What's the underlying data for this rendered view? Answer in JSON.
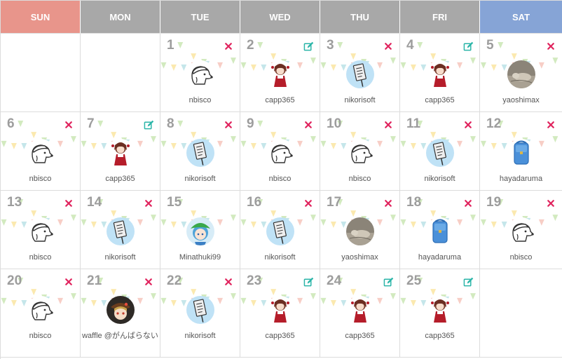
{
  "weekdays": [
    {
      "label": "SUN",
      "color": "#e8958b"
    },
    {
      "label": "MON",
      "color": "#a8a8a8"
    },
    {
      "label": "TUE",
      "color": "#a8a8a8"
    },
    {
      "label": "WED",
      "color": "#a8a8a8"
    },
    {
      "label": "THU",
      "color": "#a8a8a8"
    },
    {
      "label": "FRI",
      "color": "#a8a8a8"
    },
    {
      "label": "SAT",
      "color": "#86a4d6"
    }
  ],
  "colors": {
    "delete": "#e0245e",
    "edit": "#2bb5a8",
    "day_number": "#9d9d9d",
    "border": "#dcdcdc"
  },
  "weeks": [
    [
      {
        "day": "",
        "user": "",
        "avatar": "none",
        "action": "none"
      },
      {
        "day": "",
        "user": "",
        "avatar": "none",
        "action": "none"
      },
      {
        "day": "1",
        "user": "nbisco",
        "avatar": "dog-cap",
        "action": "delete"
      },
      {
        "day": "2",
        "user": "capp365",
        "avatar": "red-girl",
        "action": "edit"
      },
      {
        "day": "3",
        "user": "nikorisoft",
        "avatar": "sign-board",
        "action": "delete"
      },
      {
        "day": "4",
        "user": "capp365",
        "avatar": "red-girl",
        "action": "edit"
      },
      {
        "day": "5",
        "user": "yaoshimax",
        "avatar": "cat-photo",
        "action": "delete"
      }
    ],
    [
      {
        "day": "6",
        "user": "nbisco",
        "avatar": "dog-cap",
        "action": "delete"
      },
      {
        "day": "7",
        "user": "capp365",
        "avatar": "red-girl",
        "action": "edit"
      },
      {
        "day": "8",
        "user": "nikorisoft",
        "avatar": "sign-board",
        "action": "delete"
      },
      {
        "day": "9",
        "user": "nbisco",
        "avatar": "dog-cap",
        "action": "delete"
      },
      {
        "day": "10",
        "user": "nbisco",
        "avatar": "dog-cap",
        "action": "delete"
      },
      {
        "day": "11",
        "user": "nikorisoft",
        "avatar": "sign-board",
        "action": "delete"
      },
      {
        "day": "12",
        "user": "hayadaruma",
        "avatar": "blue-backpack",
        "action": "delete"
      }
    ],
    [
      {
        "day": "13",
        "user": "nbisco",
        "avatar": "dog-cap",
        "action": "delete"
      },
      {
        "day": "14",
        "user": "nikorisoft",
        "avatar": "sign-board",
        "action": "delete"
      },
      {
        "day": "15",
        "user": "Minathuki99",
        "avatar": "green-hat-girl",
        "action": "none"
      },
      {
        "day": "16",
        "user": "nikorisoft",
        "avatar": "sign-board",
        "action": "delete"
      },
      {
        "day": "17",
        "user": "yaoshimax",
        "avatar": "cat-photo",
        "action": "delete"
      },
      {
        "day": "18",
        "user": "hayadaruma",
        "avatar": "blue-backpack",
        "action": "delete"
      },
      {
        "day": "19",
        "user": "nbisco",
        "avatar": "dog-cap",
        "action": "delete"
      }
    ],
    [
      {
        "day": "20",
        "user": "nbisco",
        "avatar": "dog-cap",
        "action": "delete"
      },
      {
        "day": "21",
        "user": "waffle @がんばらない",
        "avatar": "brown-hat-girl",
        "action": "delete"
      },
      {
        "day": "22",
        "user": "nikorisoft",
        "avatar": "sign-board",
        "action": "delete"
      },
      {
        "day": "23",
        "user": "capp365",
        "avatar": "red-girl",
        "action": "edit"
      },
      {
        "day": "24",
        "user": "capp365",
        "avatar": "red-girl",
        "action": "edit"
      },
      {
        "day": "25",
        "user": "capp365",
        "avatar": "red-girl",
        "action": "edit"
      },
      {
        "day": "",
        "user": "",
        "avatar": "none",
        "action": "none"
      }
    ]
  ]
}
